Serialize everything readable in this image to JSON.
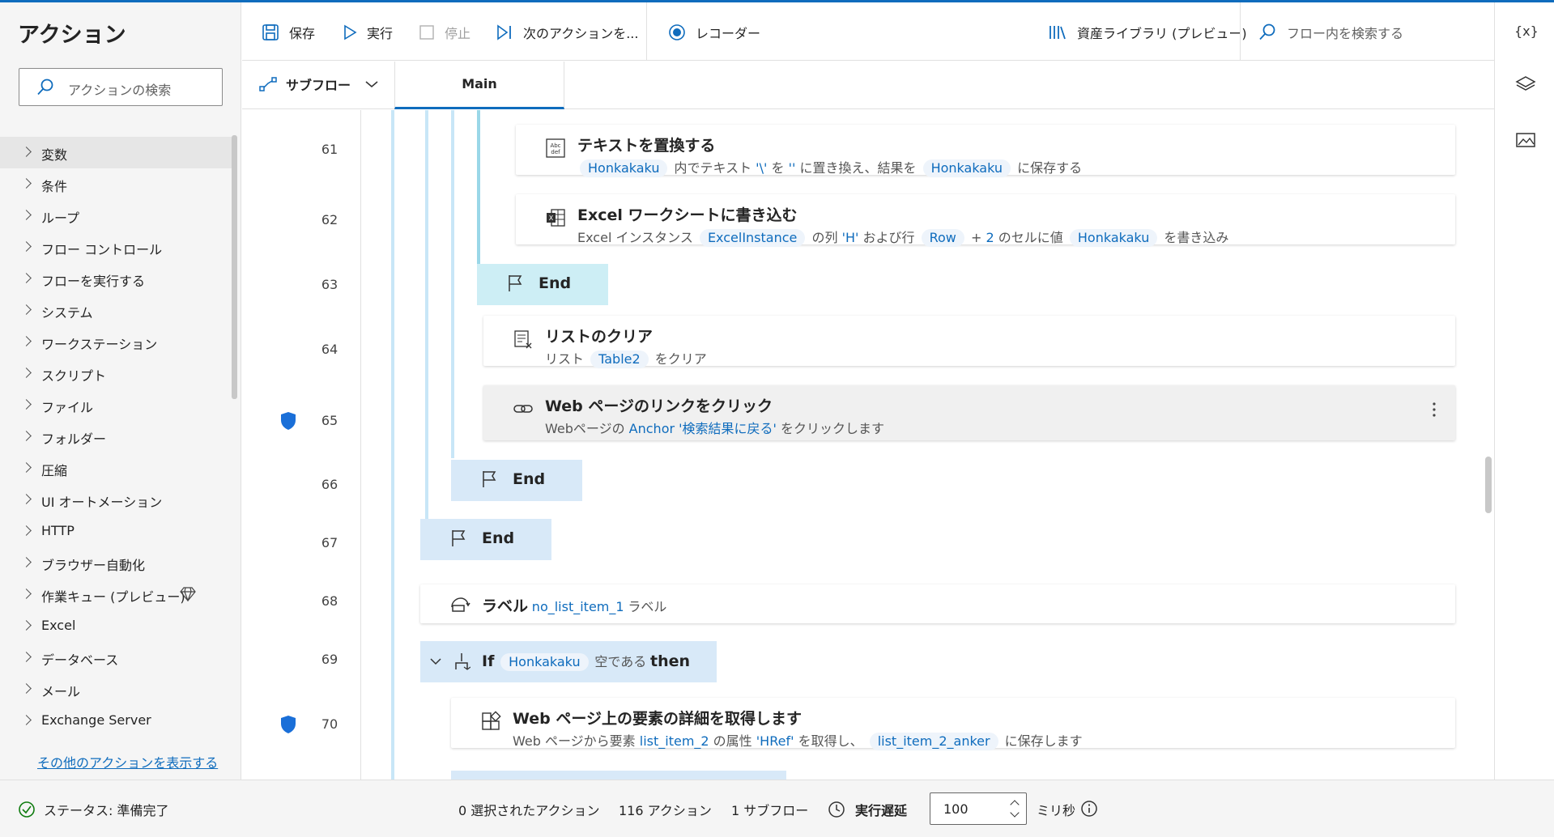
{
  "left_panel": {
    "title": "アクション",
    "search_placeholder": "アクションの検索",
    "categories": [
      "変数",
      "条件",
      "ループ",
      "フロー コントロール",
      "フローを実行する",
      "システム",
      "ワークステーション",
      "スクリプト",
      "ファイル",
      "フォルダー",
      "圧縮",
      "UI オートメーション",
      "HTTP",
      "ブラウザー自動化",
      "作業キュー (プレビュー)",
      "Excel",
      "データベース",
      "メール",
      "Exchange Server"
    ],
    "more_link": "その他のアクションを表示する"
  },
  "toolbar": {
    "save": "保存",
    "run": "実行",
    "stop": "停止",
    "next_action": "次のアクションを...",
    "recorder": "レコーダー",
    "asset_library": "資産ライブラリ (プレビュー)",
    "flow_search": "フロー内を検索する"
  },
  "tabs": {
    "subflow": "サブフロー",
    "main": "Main"
  },
  "right_strip": {
    "variables_icon_text": "{x}"
  },
  "flow": {
    "rows": {
      "r61": "61",
      "r62": "62",
      "r63": "63",
      "r64": "64",
      "r65": "65",
      "r66": "66",
      "r67": "67",
      "r68": "68",
      "r69": "69",
      "r70": "70"
    },
    "a61": {
      "title": "テキストを置換する",
      "tok1": "Honkakaku",
      "t1": "内でテキスト",
      "lit1": "'\\'",
      "t2": "を",
      "lit2": "''",
      "t3": "に置き換え、結果を",
      "tok2": "Honkakaku",
      "t4": "に保存する"
    },
    "a62": {
      "title": "Excel ワークシートに書き込む",
      "t1": "Excel インスタンス",
      "tok1": "ExcelInstance",
      "t2": "の列",
      "lit1": "'H'",
      "t3": "および行",
      "tok2": "Row",
      "t4": "+",
      "lit2": "2",
      "t5": "のセルに値",
      "tok3": "Honkakaku",
      "t6": "を書き込み"
    },
    "end": "End",
    "a64": {
      "title": "リストのクリア",
      "t1": "リスト",
      "tok1": "Table2",
      "t2": "をクリア"
    },
    "a65": {
      "title": "Web ページのリンクをクリック",
      "t1": "Webページの",
      "lit1": "Anchor '検索結果に戻る'",
      "t2": "をクリックします"
    },
    "a68": {
      "title": "ラベル",
      "lit1": "no_list_item_1",
      "t1": "ラベル"
    },
    "a69": {
      "kw_if": "If",
      "tok1": "Honkakaku",
      "t1": "空である",
      "kw_then": "then"
    },
    "a70": {
      "title": "Web ページ上の要素の詳細を取得します",
      "t1": "Web ページから要素",
      "lit1": "list_item_2",
      "t2": "の属性",
      "lit2": "'HRef'",
      "t3": "を取得し、",
      "tok1": "list_item_2_anker",
      "t4": "に保存します"
    }
  },
  "status": {
    "state": "ステータス: 準備完了",
    "selected": "0 選択されたアクション",
    "actions": "116 アクション",
    "subflows": "1 サブフロー",
    "delay_label": "実行遅延",
    "delay_value": "100",
    "unit": "ミリ秒"
  },
  "colors": {
    "accent": "#0f6cbd",
    "block_light_blue": "#d8e9f8",
    "block_teal": "#cdeef5",
    "bar_light": "#c8e6f7",
    "shield": "#1a6fd8"
  }
}
